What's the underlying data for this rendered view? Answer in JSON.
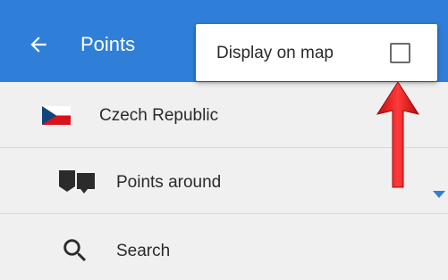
{
  "colors": {
    "app_bar": "#2f7fd9",
    "list_background": "#f0f0f0",
    "divider": "#dadada",
    "annotation_arrow": "#e21b1b",
    "flag_white": "#ffffff",
    "flag_red": "#d7141a",
    "flag_blue": "#11457e"
  },
  "app_bar": {
    "back_icon": "arrow-left-icon",
    "title": "Points"
  },
  "popup_menu": {
    "items": [
      {
        "label": "Display on map",
        "checked": false
      }
    ]
  },
  "list": {
    "items": [
      {
        "icon": "czech-flag-icon",
        "label": "Czech Republic",
        "trailing_icon": "chevron-down-icon"
      },
      {
        "icon": "points-around-icon",
        "label": "Points around"
      },
      {
        "icon": "search-icon",
        "label": "Search"
      }
    ]
  },
  "annotation": {
    "icon": "red-arrow-icon",
    "points_to": "Display on map checkbox"
  }
}
